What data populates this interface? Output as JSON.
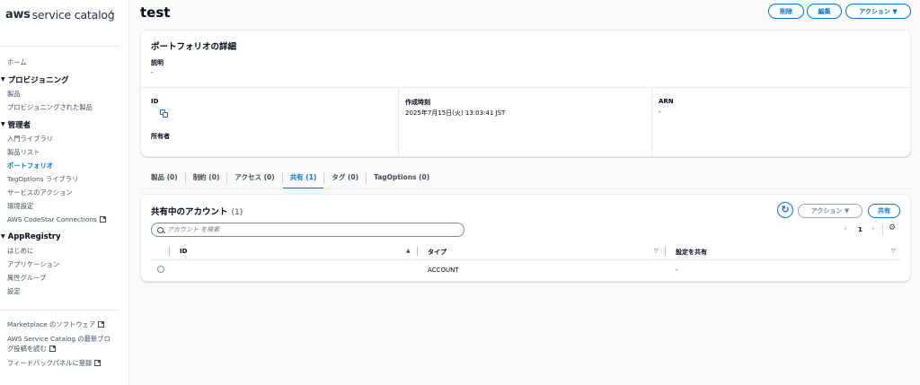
{
  "brand": {
    "logo": "aws",
    "name": "service catalog"
  },
  "sidebar": {
    "top_items": [
      "ホーム"
    ],
    "sections": [
      {
        "title": "プロビジョニング",
        "items": [
          "製品",
          "プロビジョニングされた製品"
        ]
      },
      {
        "title": "管理者",
        "items": [
          "入門ライブラリ",
          "製品リスト",
          "ポートフォリオ",
          "TagOptions ライブラリ",
          "サービスのアクション",
          "環境設定",
          "AWS CodeStar Connections"
        ]
      },
      {
        "title": "AppRegistry",
        "items": [
          "はじめに",
          "アプリケーション",
          "属性グループ",
          "設定"
        ]
      }
    ],
    "active_item": "ポートフォリオ",
    "bottom_links": [
      "Marketplace のソフトウェア",
      "AWS Service Catalog の最新ブログ投稿を読む",
      "フィードバックパネルに登録"
    ]
  },
  "header": {
    "title": "test",
    "delete_label": "削除",
    "edit_label": "編集",
    "actions_label": "アクション ▼"
  },
  "details": {
    "title": "ポートフォリオの詳細",
    "description_label": "説明",
    "description_value": "-",
    "id_label": "ID",
    "owner_label": "所有者",
    "created_label": "作成時刻",
    "created_value": "2025年7月15日(火) 13:03:41 JST",
    "arn_label": "ARN",
    "arn_value": "-"
  },
  "tabs": [
    {
      "label": "製品 (0)"
    },
    {
      "label": "制約 (0)"
    },
    {
      "label": "アクセス (0)"
    },
    {
      "label": "共有 (1)",
      "active": true
    },
    {
      "label": "タグ (0)"
    },
    {
      "label": "TagOptions (0)"
    }
  ],
  "shares": {
    "title": "共有中のアカウント",
    "count": "(1)",
    "actions_label": "アクション ▼",
    "share_label": "共有",
    "search_placeholder": "アカウント を検索",
    "page": "1",
    "columns": [
      "ID",
      "タイプ",
      "設定を共有"
    ],
    "rows": [
      {
        "id": "",
        "type": "ACCOUNT",
        "setting": "-"
      }
    ]
  },
  "colors": {
    "accent": "#0972d3",
    "text": "#000716",
    "border": "#e9ebed"
  }
}
